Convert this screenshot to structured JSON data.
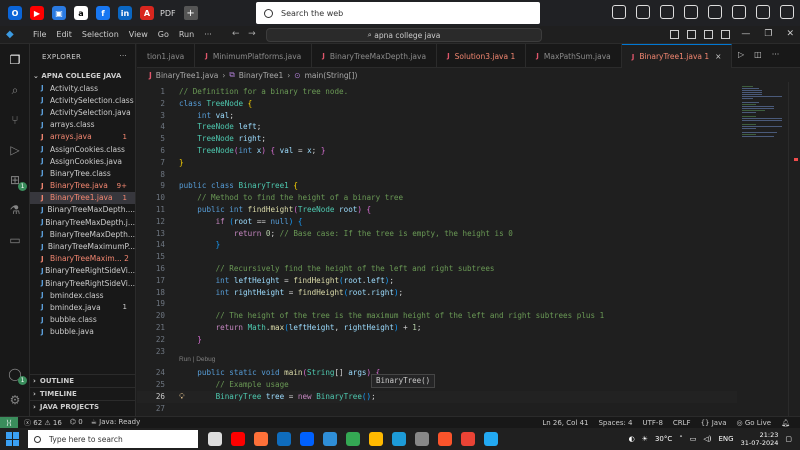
{
  "browser": {
    "bookmarks": [
      {
        "name": "outlook-icon",
        "color": "#0a64d8",
        "glyph": "O"
      },
      {
        "name": "youtube-icon",
        "color": "#ff0000",
        "glyph": "▶"
      },
      {
        "name": "photos-icon",
        "color": "#2a7ae2",
        "glyph": "▣"
      },
      {
        "name": "amazon-icon",
        "color": "#ffffff",
        "glyph": "a"
      },
      {
        "name": "facebook-icon",
        "color": "#1877f2",
        "glyph": "f"
      },
      {
        "name": "linkedin-icon",
        "color": "#0a66c2",
        "glyph": "in"
      },
      {
        "name": "pdf-icon",
        "color": "#d8261e",
        "glyph": "A"
      }
    ],
    "pdf_label": "PDF",
    "search_placeholder": "Search the web"
  },
  "vscode": {
    "menu": [
      "File",
      "Edit",
      "Selection",
      "View",
      "Go",
      "Run",
      "···"
    ],
    "command_center": "apna college java",
    "explorer_title": "EXPLORER",
    "folder": "APNA COLLEGE JAVA",
    "files": [
      {
        "name": "Activity.class",
        "state": "normal",
        "count": ""
      },
      {
        "name": "ActivitySelection.class",
        "state": "normal",
        "count": ""
      },
      {
        "name": "ActivitySelection.java",
        "state": "normal",
        "count": ""
      },
      {
        "name": "arrays.class",
        "state": "normal",
        "count": ""
      },
      {
        "name": "arrays.java",
        "state": "err",
        "count": "1"
      },
      {
        "name": "AssignCookies.class",
        "state": "normal",
        "count": ""
      },
      {
        "name": "AssignCookies.java",
        "state": "normal",
        "count": ""
      },
      {
        "name": "BinaryTree.class",
        "state": "normal",
        "count": ""
      },
      {
        "name": "BinaryTree.java",
        "state": "err",
        "count": "9+"
      },
      {
        "name": "BinaryTree1.java",
        "state": "err-selected",
        "count": "1"
      },
      {
        "name": "BinaryTreeMaxDepth....",
        "state": "normal",
        "count": ""
      },
      {
        "name": "BinaryTreeMaxDepth.j...",
        "state": "normal",
        "count": ""
      },
      {
        "name": "BinaryTreeMaxDepth...",
        "state": "normal",
        "count": ""
      },
      {
        "name": "BinaryTreeMaximumP...",
        "state": "normal",
        "count": ""
      },
      {
        "name": "BinaryTreeMaxim... 2",
        "state": "err",
        "count": ""
      },
      {
        "name": "BinaryTreeRightSideVi...",
        "state": "normal",
        "count": ""
      },
      {
        "name": "BinaryTreeRightSideVi...",
        "state": "normal",
        "count": ""
      },
      {
        "name": "bmindex.class",
        "state": "normal",
        "count": ""
      },
      {
        "name": "bmindex.java",
        "state": "normal",
        "count": "1"
      },
      {
        "name": "bubble.class",
        "state": "normal",
        "count": ""
      },
      {
        "name": "bubble.java",
        "state": "normal",
        "count": ""
      }
    ],
    "sections": [
      "OUTLINE",
      "TIMELINE",
      "JAVA PROJECTS"
    ],
    "tabs": [
      {
        "label": "tion1.java",
        "state": "normal"
      },
      {
        "label": "MinimumPlatforms.java",
        "state": "normal"
      },
      {
        "label": "BinaryTreeMaxDepth.java",
        "state": "normal"
      },
      {
        "label": "Solution3.java 1",
        "state": "err"
      },
      {
        "label": "MaxPathSum.java",
        "state": "normal"
      },
      {
        "label": "BinaryTree1.java 1",
        "state": "active"
      }
    ],
    "breadcrumb": {
      "file": "BinaryTree1.java",
      "cls": "BinaryTree1",
      "method": "main(String[])"
    },
    "codelens": "Run | Debug",
    "tooltip": "BinaryTree()",
    "status": {
      "errors": "62",
      "warnings": "16",
      "ports": "0",
      "java": "Java: Ready",
      "position": "Ln 26, Col 41",
      "spaces": "Spaces: 4",
      "encoding": "UTF-8",
      "eol": "CRLF",
      "lang": "Java",
      "golive": "Go Live"
    }
  },
  "code": [
    {
      "n": "1",
      "t": [
        [
          "cm",
          "// Definition for a binary tree node."
        ]
      ]
    },
    {
      "n": "2",
      "t": [
        [
          "kw",
          "class "
        ],
        [
          "ty",
          "TreeNode "
        ],
        [
          "br1",
          "{"
        ]
      ]
    },
    {
      "n": "3",
      "t": [
        [
          "pl",
          "    "
        ],
        [
          "kw",
          "int "
        ],
        [
          "vr",
          "val"
        ],
        [
          "pl",
          ";"
        ]
      ]
    },
    {
      "n": "4",
      "t": [
        [
          "pl",
          "    "
        ],
        [
          "ty",
          "TreeNode "
        ],
        [
          "vr",
          "left"
        ],
        [
          "pl",
          ";"
        ]
      ]
    },
    {
      "n": "5",
      "t": [
        [
          "pl",
          "    "
        ],
        [
          "ty",
          "TreeNode "
        ],
        [
          "vr",
          "right"
        ],
        [
          "pl",
          ";"
        ]
      ]
    },
    {
      "n": "6",
      "t": [
        [
          "pl",
          "    "
        ],
        [
          "ty",
          "TreeNode"
        ],
        [
          "br2",
          "("
        ],
        [
          "kw",
          "int "
        ],
        [
          "vr",
          "x"
        ],
        [
          "br2",
          ") "
        ],
        [
          "br2",
          "{ "
        ],
        [
          "vr",
          "val "
        ],
        [
          "pl",
          "= "
        ],
        [
          "vr",
          "x"
        ],
        [
          "pl",
          "; "
        ],
        [
          "br2",
          "}"
        ]
      ]
    },
    {
      "n": "7",
      "t": [
        [
          "br1",
          "}"
        ]
      ]
    },
    {
      "n": "8",
      "t": []
    },
    {
      "n": "9",
      "t": [
        [
          "kw",
          "public class "
        ],
        [
          "ty",
          "BinaryTree1 "
        ],
        [
          "br1",
          "{"
        ]
      ]
    },
    {
      "n": "10",
      "t": [
        [
          "pl",
          "    "
        ],
        [
          "cm",
          "// Method to find the height of a binary tree"
        ]
      ]
    },
    {
      "n": "11",
      "t": [
        [
          "pl",
          "    "
        ],
        [
          "kw",
          "public int "
        ],
        [
          "fn",
          "findHeight"
        ],
        [
          "br2",
          "("
        ],
        [
          "ty",
          "TreeNode "
        ],
        [
          "vr",
          "root"
        ],
        [
          "br2",
          ") "
        ],
        [
          "br2",
          "{"
        ]
      ]
    },
    {
      "n": "12",
      "t": [
        [
          "pl",
          "        "
        ],
        [
          "kc",
          "if "
        ],
        [
          "br3",
          "("
        ],
        [
          "vr",
          "root "
        ],
        [
          "pl",
          "== "
        ],
        [
          "kw",
          "null"
        ],
        [
          "br3",
          ") "
        ],
        [
          "br3",
          "{"
        ]
      ]
    },
    {
      "n": "13",
      "t": [
        [
          "pl",
          "            "
        ],
        [
          "kc",
          "return "
        ],
        [
          "nm",
          "0"
        ],
        [
          "pl",
          "; "
        ],
        [
          "cm",
          "// Base case: If the tree is empty, the height is 0"
        ]
      ]
    },
    {
      "n": "14",
      "t": [
        [
          "pl",
          "        "
        ],
        [
          "br3",
          "}"
        ]
      ]
    },
    {
      "n": "15",
      "t": []
    },
    {
      "n": "16",
      "t": [
        [
          "pl",
          "        "
        ],
        [
          "cm",
          "// Recursively find the height of the left and right subtrees"
        ]
      ]
    },
    {
      "n": "17",
      "t": [
        [
          "pl",
          "        "
        ],
        [
          "kw",
          "int "
        ],
        [
          "vr",
          "leftHeight "
        ],
        [
          "pl",
          "= "
        ],
        [
          "fn",
          "findHeight"
        ],
        [
          "br3",
          "("
        ],
        [
          "vr",
          "root"
        ],
        [
          "pl",
          "."
        ],
        [
          "vr",
          "left"
        ],
        [
          "br3",
          ")"
        ],
        [
          "pl",
          ";"
        ]
      ]
    },
    {
      "n": "18",
      "t": [
        [
          "pl",
          "        "
        ],
        [
          "kw",
          "int "
        ],
        [
          "vr",
          "rightHeight "
        ],
        [
          "pl",
          "= "
        ],
        [
          "fn",
          "findHeight"
        ],
        [
          "br3",
          "("
        ],
        [
          "vr",
          "root"
        ],
        [
          "pl",
          "."
        ],
        [
          "vr",
          "right"
        ],
        [
          "br3",
          ")"
        ],
        [
          "pl",
          ";"
        ]
      ]
    },
    {
      "n": "19",
      "t": []
    },
    {
      "n": "20",
      "t": [
        [
          "pl",
          "        "
        ],
        [
          "cm",
          "// The height of the tree is the maximum height of the left and right subtrees plus 1"
        ]
      ]
    },
    {
      "n": "21",
      "t": [
        [
          "pl",
          "        "
        ],
        [
          "kc",
          "return "
        ],
        [
          "ty",
          "Math"
        ],
        [
          "pl",
          "."
        ],
        [
          "fn",
          "max"
        ],
        [
          "br3",
          "("
        ],
        [
          "vr",
          "leftHeight"
        ],
        [
          "pl",
          ", "
        ],
        [
          "vr",
          "rightHeight"
        ],
        [
          "br3",
          ") "
        ],
        [
          "pl",
          "+ "
        ],
        [
          "nm",
          "1"
        ],
        [
          "pl",
          ";"
        ]
      ]
    },
    {
      "n": "22",
      "t": [
        [
          "pl",
          "    "
        ],
        [
          "br2",
          "}"
        ]
      ]
    },
    {
      "n": "23",
      "t": []
    },
    {
      "n": "24",
      "t": [
        [
          "pl",
          "    "
        ],
        [
          "kw",
          "public static void "
        ],
        [
          "fn",
          "main"
        ],
        [
          "br2",
          "("
        ],
        [
          "ty",
          "String"
        ],
        [
          "pl",
          "[] "
        ],
        [
          "vr",
          "args"
        ],
        [
          "br2",
          ") "
        ],
        [
          "br2",
          "{"
        ]
      ]
    },
    {
      "n": "25",
      "t": [
        [
          "pl",
          "        "
        ],
        [
          "cm",
          "// Example usage"
        ]
      ]
    },
    {
      "n": "26",
      "t": [
        [
          "pl",
          "        "
        ],
        [
          "ty",
          "BinaryTree "
        ],
        [
          "vr",
          "tree "
        ],
        [
          "pl",
          "= "
        ],
        [
          "kc",
          "new "
        ],
        [
          "ty",
          "BinaryTree"
        ],
        [
          "br3",
          "()"
        ],
        [
          "pl",
          ";"
        ]
      ]
    },
    {
      "n": "27",
      "t": []
    }
  ],
  "taskbar": {
    "search_placeholder": "Type here to search",
    "apps": [
      {
        "name": "task-view-icon",
        "color": "#dddddd"
      },
      {
        "name": "youtube-app-icon",
        "color": "#ff0000"
      },
      {
        "name": "firefox-icon",
        "color": "#ff7139"
      },
      {
        "name": "mail-icon",
        "color": "#0f6cbd"
      },
      {
        "name": "dropbox-icon",
        "color": "#0061ff"
      },
      {
        "name": "weather-app-icon",
        "color": "#2f8fd8"
      },
      {
        "name": "chrome-icon",
        "color": "#34a853"
      },
      {
        "name": "files-icon",
        "color": "#ffb900"
      },
      {
        "name": "edge-icon",
        "color": "#1d9bd8"
      },
      {
        "name": "settings-app-icon",
        "color": "#888888"
      },
      {
        "name": "brave-icon",
        "color": "#fb542b"
      },
      {
        "name": "chrome-profile-icon",
        "color": "#ea4335"
      },
      {
        "name": "vscode-app-icon",
        "color": "#23a9f2"
      }
    ],
    "temperature": "30°C",
    "language": "ENG",
    "time": "21:23",
    "date": "31-07-2024"
  }
}
